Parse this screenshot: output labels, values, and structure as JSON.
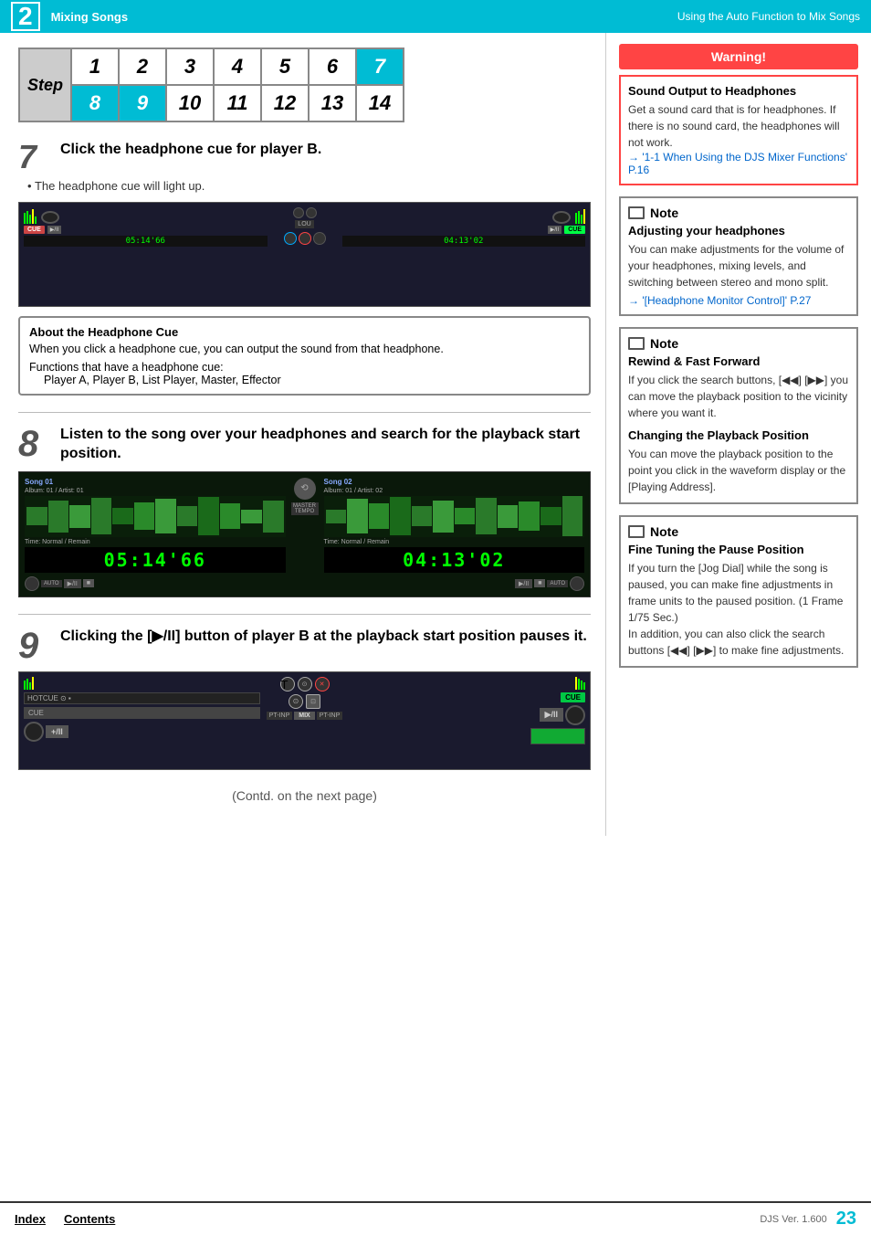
{
  "page": {
    "chapter_num": "2",
    "top_title": "Mixing Songs",
    "top_right": "Using the Auto Function to Mix Songs",
    "page_num": "23",
    "djs_ver": "DJS Ver. 1.600"
  },
  "step_table": {
    "label": "Step",
    "row1": [
      "1",
      "2",
      "3",
      "4",
      "5",
      "6",
      "7"
    ],
    "row2": [
      "8",
      "9",
      "10",
      "11",
      "12",
      "13",
      "14"
    ]
  },
  "step7": {
    "icon": "7",
    "text": "Click the headphone cue for player B.",
    "bullet": "The headphone cue will light up."
  },
  "headphone_info": {
    "title": "About the Headphone Cue",
    "body": "When you click a headphone cue, you can output the sound from that headphone.",
    "functions_label": "Functions that have a headphone cue:",
    "functions_list": "Player A, Player B, List Player, Master, Effector"
  },
  "step8": {
    "icon": "8",
    "text": "Listen to the song over your headphones and search for the playback start position."
  },
  "waveform": {
    "song1_label": "Song 01",
    "song1_sub": "Album: 01 / Artist: 01",
    "song2_label": "Song 02",
    "song2_sub": "Album: 01 / Artist: 02",
    "time1": "05:14'66",
    "time2": "04:13'02",
    "time1_label": "Time: Normal / Remain",
    "time2_label": "Time: Normal / Remain"
  },
  "step9": {
    "icon": "9",
    "text": "Clicking the [▶/II] button of player B at the playback start position pauses it."
  },
  "deck_controls": {
    "hotcue": "HOTCUE",
    "mix": "MIX",
    "pt_inp": "PT-INP",
    "cue": "CUE"
  },
  "contd": "(Contd. on the next page)",
  "warning": {
    "header": "Warning!",
    "title": "Sound Output to Headphones",
    "body": "Get a sound card that is for headphones. If there is no sound card, the headphones will not work.",
    "link": "→ '1-1 When Using the DJS Mixer Functions' P.16"
  },
  "note1": {
    "label": "Note",
    "title": "Adjusting your headphones",
    "body": "You can make adjustments for the volume of your headphones, mixing levels, and switching between stereo and mono split.",
    "link": "→ '[Headphone Monitor Control]' P.27"
  },
  "note2": {
    "label": "Note",
    "title": "Rewind & Fast Forward",
    "body_p1": "If you click the search buttons, [◀◀] [▶▶] you can move the playback position to the vicinity where you want it.",
    "title2": "Changing the Playback Position",
    "body_p2": "You can move the playback position to the point you click in the waveform display or the [Playing Address]."
  },
  "note3": {
    "label": "Note",
    "title": "Fine Tuning the Pause Position",
    "body": "If you turn the [Jog Dial] while the song is paused, you can make fine adjustments in frame units to the paused position. (1 Frame　1/75 Sec.)\nIn addition, you can also click the search buttons [◀◀] [▶▶] to make fine adjustments."
  },
  "footer": {
    "index": "Index",
    "contents": "Contents"
  }
}
